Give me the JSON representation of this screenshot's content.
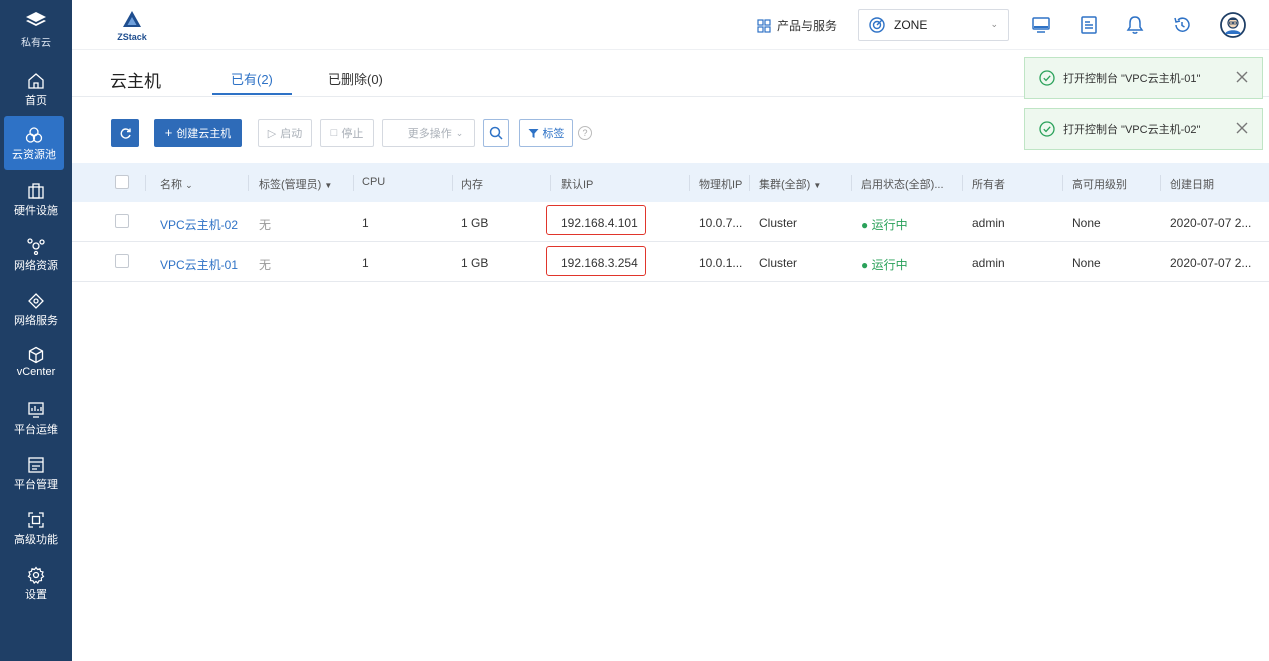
{
  "sidebar": {
    "brand": "私有云",
    "items": [
      {
        "label": "首页",
        "icon": "home-icon"
      },
      {
        "label": "云资源池",
        "icon": "resource-pool-icon"
      },
      {
        "label": "硬件设施",
        "icon": "hardware-icon"
      },
      {
        "label": "网络资源",
        "icon": "network-resource-icon"
      },
      {
        "label": "网络服务",
        "icon": "network-service-icon"
      },
      {
        "label": "vCenter",
        "icon": "vcenter-icon"
      },
      {
        "label": "平台运维",
        "icon": "ops-icon"
      },
      {
        "label": "平台管理",
        "icon": "platform-manage-icon"
      },
      {
        "label": "高级功能",
        "icon": "advanced-icon"
      },
      {
        "label": "设置",
        "icon": "settings-icon"
      }
    ],
    "active_index": 1
  },
  "header": {
    "logo_text": "ZStack",
    "products_label": "产品与服务",
    "zone_label": "ZONE"
  },
  "page": {
    "title": "云主机",
    "tabs": [
      "已有(2)",
      "已删除(0)"
    ]
  },
  "toolbar": {
    "create": "创建云主机",
    "start": "启动",
    "stop": "停止",
    "more": "更多操作",
    "tag": "标签"
  },
  "table": {
    "columns": [
      "名称",
      "标签(管理员)",
      "CPU",
      "内存",
      "默认IP",
      "物理机IP",
      "集群(全部)",
      "启用状态(全部)...",
      "所有者",
      "高可用级别",
      "创建日期"
    ],
    "rows": [
      {
        "name": "VPC云主机-02",
        "tag": "无",
        "cpu": "1",
        "mem": "1 GB",
        "ip": "192.168.4.101",
        "host_ip": "10.0.7...",
        "cluster": "Cluster",
        "status": "运行中",
        "owner": "admin",
        "ha": "None",
        "created": "2020-07-07 2..."
      },
      {
        "name": "VPC云主机-01",
        "tag": "无",
        "cpu": "1",
        "mem": "1 GB",
        "ip": "192.168.3.254",
        "host_ip": "10.0.1...",
        "cluster": "Cluster",
        "status": "运行中",
        "owner": "admin",
        "ha": "None",
        "created": "2020-07-07 2..."
      }
    ]
  },
  "toasts": [
    {
      "message": "打开控制台 \"VPC云主机-01\""
    },
    {
      "message": "打开控制台 \"VPC云主机-02\""
    }
  ],
  "colors": {
    "sidebar_bg": "#1f3f66",
    "accent": "#2e72c6",
    "success": "#2aa15a",
    "highlight": "#e0352b"
  }
}
